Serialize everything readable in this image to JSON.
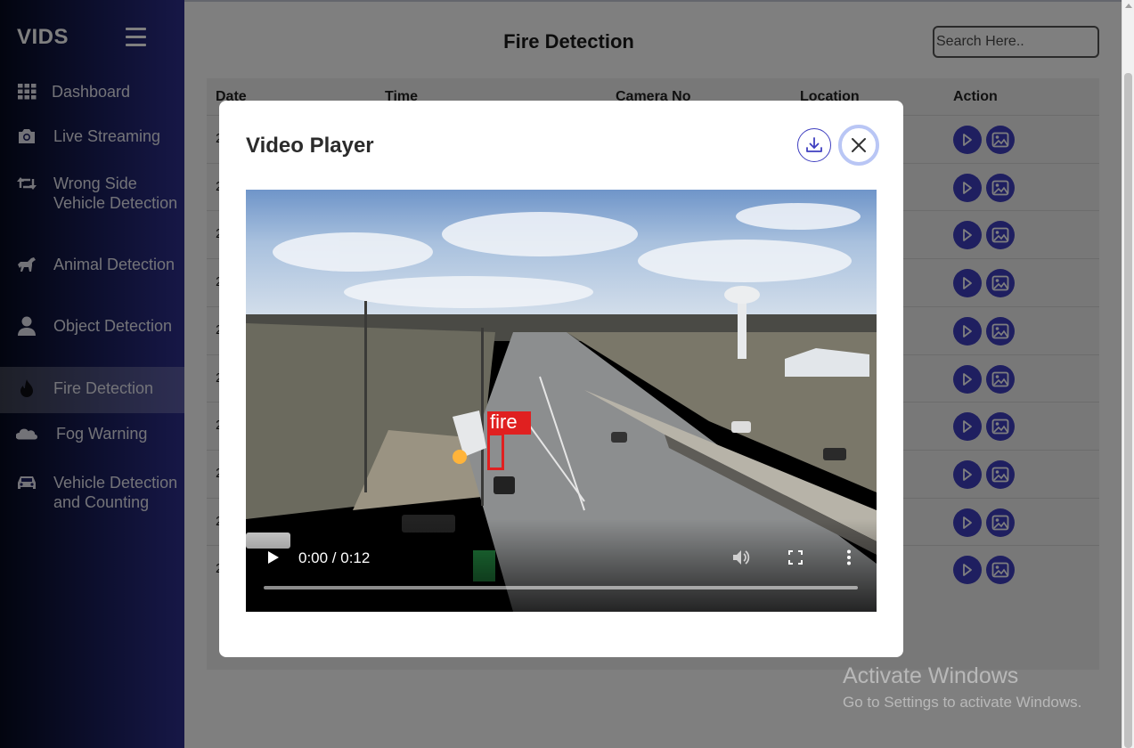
{
  "sidebar": {
    "brand": "VIDS",
    "items": [
      {
        "label": "Dashboard",
        "icon": "grid-icon"
      },
      {
        "label": "Live Streaming",
        "icon": "camera-icon"
      },
      {
        "label": "Wrong Side Vehicle Detection",
        "icon": "retweet-icon"
      },
      {
        "label": "Animal Detection",
        "icon": "horse-icon"
      },
      {
        "label": "Object Detection",
        "icon": "user-icon"
      },
      {
        "label": "Fire Detection",
        "icon": "fire-icon",
        "active": true
      },
      {
        "label": "Fog Warning",
        "icon": "cloud-icon"
      },
      {
        "label": "Vehicle Detection and Counting",
        "icon": "car-icon"
      }
    ]
  },
  "header": {
    "title": "Fire Detection",
    "search_placeholder": "Search Here.."
  },
  "table": {
    "columns": [
      "Date",
      "Time",
      "Camera No",
      "Location",
      "Action"
    ],
    "rows": [
      {
        "date_prefix": "2"
      },
      {
        "date_prefix": "2"
      },
      {
        "date_prefix": "2"
      },
      {
        "date_prefix": "2"
      },
      {
        "date_prefix": "2"
      },
      {
        "date_prefix": "2"
      },
      {
        "date_prefix": "2"
      },
      {
        "date_prefix": "2"
      },
      {
        "date_prefix": "2"
      },
      {
        "date_prefix": "2"
      }
    ]
  },
  "modal": {
    "title": "Video Player",
    "video": {
      "current_time": "0:00",
      "duration": "0:12",
      "time_display": "0:00 / 0:12",
      "detection_label": "fire",
      "progress": 0
    }
  },
  "watermark": {
    "line1": "Activate Windows",
    "line2": "Go to Settings to activate Windows."
  },
  "colors": {
    "accent": "#3f3fc0",
    "detection": "#e02020"
  }
}
